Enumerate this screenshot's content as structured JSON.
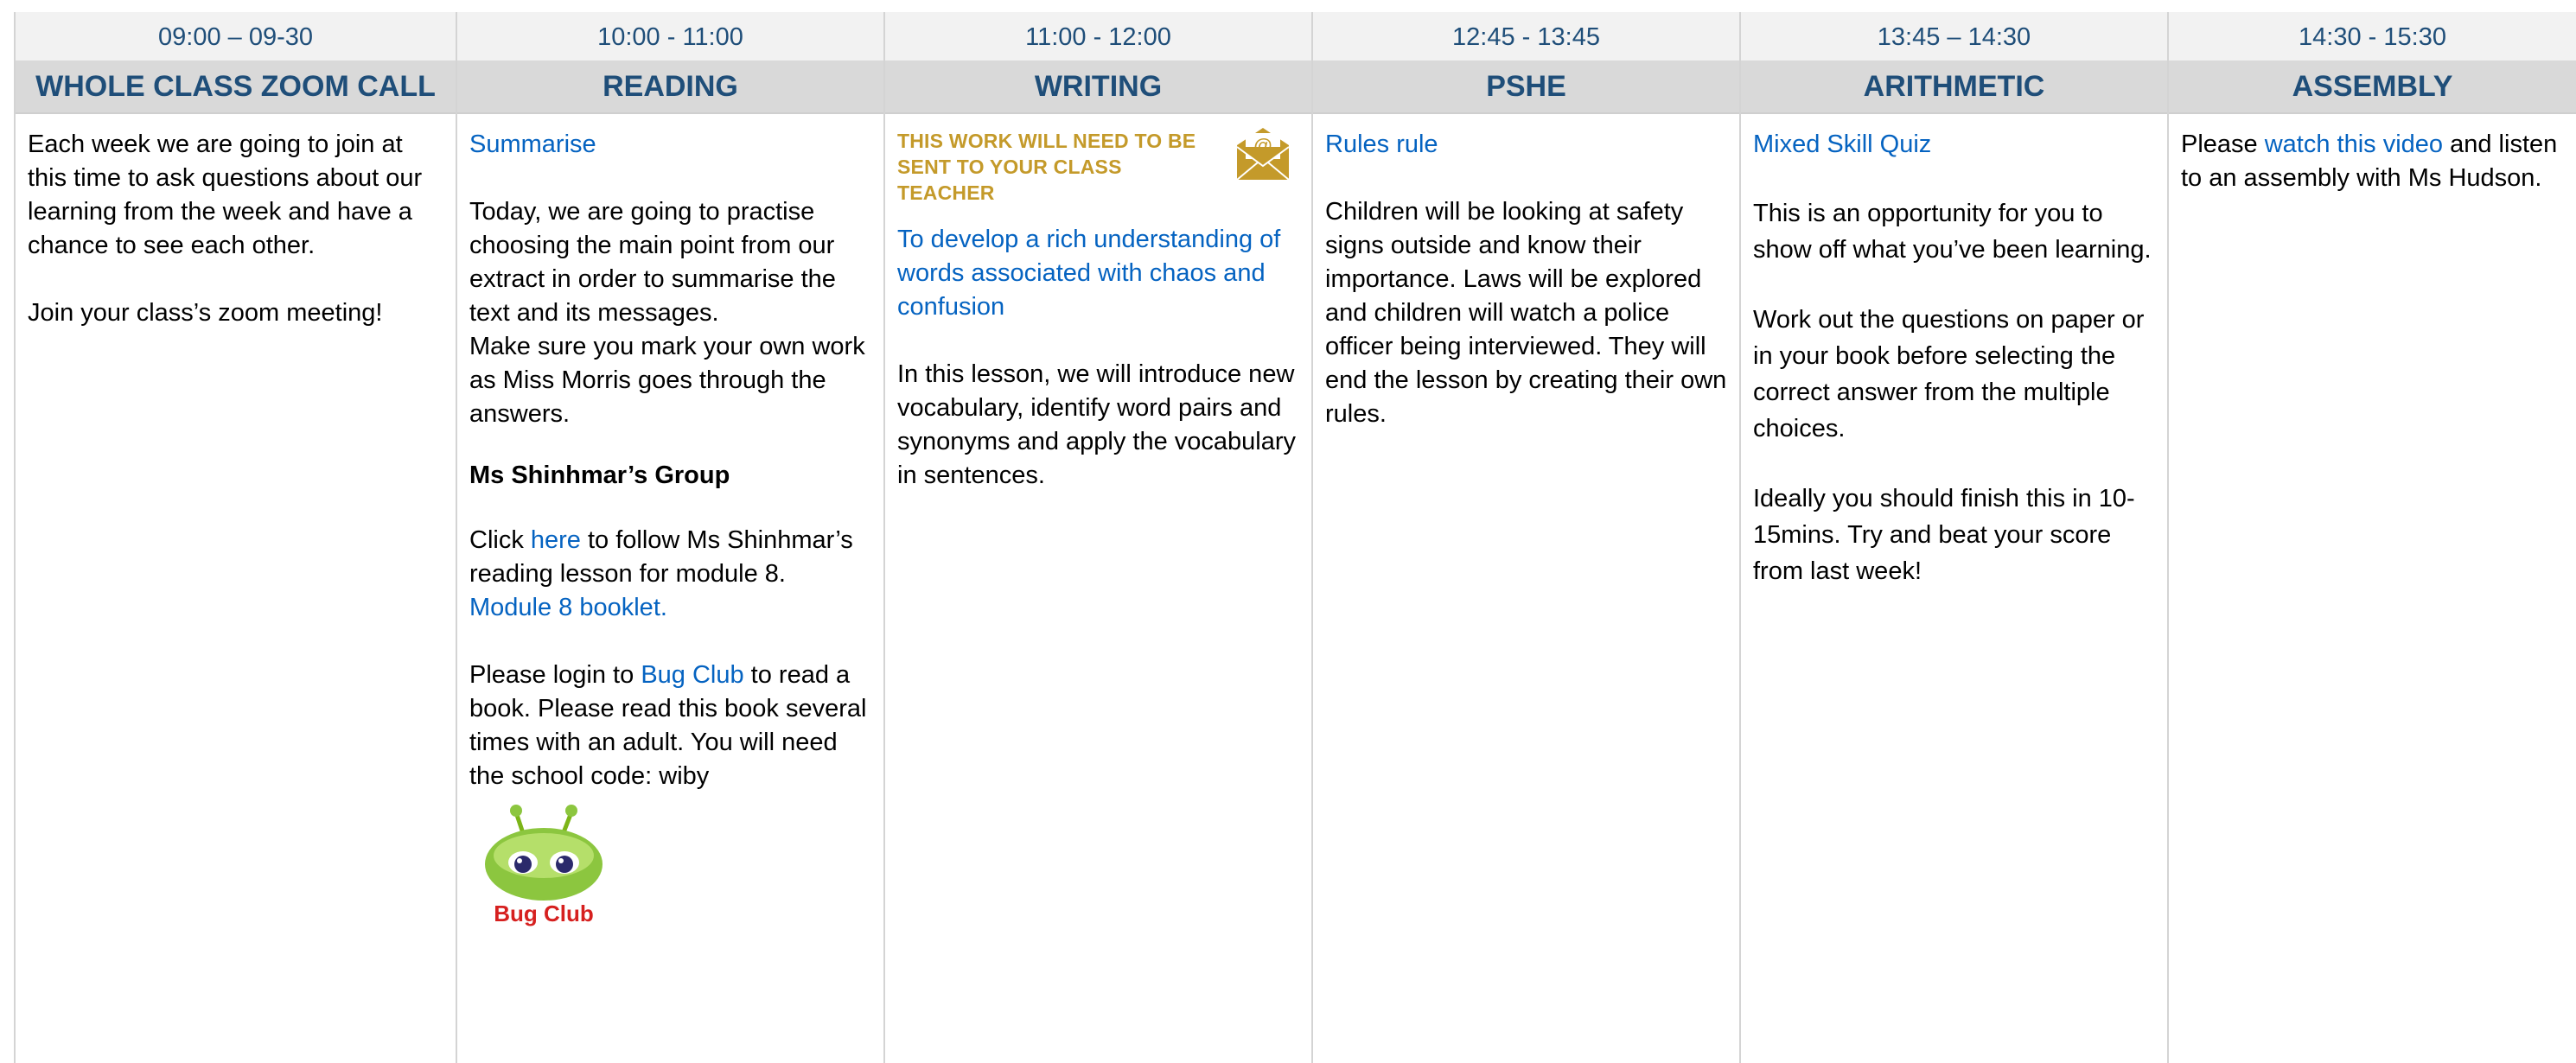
{
  "columns": [
    {
      "time": "09:00 – 09-30",
      "subject": "WHOLE CLASS ZOOM CALL",
      "p1": "Each week we are going to join at this time to ask questions about our learning from the week and have a chance to see each other.",
      "p2": "Join your class’s zoom meeting!"
    },
    {
      "time": "10:00 - 11:00",
      "subject": "READING",
      "title_link": "Summarise",
      "p1": "Today, we are going to practise choosing the main point from our extract in order to summarise the text and its messages.",
      "p2": "Make sure you mark your own work as Miss Morris goes through the answers.",
      "group_heading": "Ms Shinhmar’s Group",
      "click_pre": "Click ",
      "click_link": "here",
      "click_post": " to follow Ms Shinhmar’s reading lesson for module 8.",
      "booklet_link": "Module 8 booklet.",
      "login_pre": "Please login to ",
      "login_link": "Bug Club",
      "login_post": " to read a book.  Please read this book several times with an adult. You will need the school code: wiby",
      "logo_text": "Bug Club"
    },
    {
      "time": "11:00 - 12:00",
      "subject": "WRITING",
      "notice": "THIS WORK WILL NEED TO BE SENT TO YOUR CLASS TEACHER",
      "objective_link": "To develop a rich understanding of words associated with chaos and confusion",
      "p1": "In this lesson, we will introduce new vocabulary, identify word pairs and synonyms and apply the vocabulary in sentences."
    },
    {
      "time": "12:45 - 13:45",
      "subject": "PSHE",
      "title_link": "Rules rule",
      "p1": "Children will be looking at safety signs outside and know their importance. Laws will be explored and children will watch a police officer being interviewed. They will end the lesson by creating their own rules."
    },
    {
      "time": "13:45 – 14:30",
      "subject": "ARITHMETIC",
      "title_link": "Mixed Skill Quiz",
      "p1": "This is an opportunity for you to show off what you’ve been learning.",
      "p2": "Work out the questions on paper or in your book before selecting the correct answer from the multiple choices.",
      "p3": "Ideally you should finish this in 10-15mins.  Try and beat your score from last week!"
    },
    {
      "time": "14:30 - 15:30",
      "subject": "ASSEMBLY",
      "pre": "Please ",
      "link": "watch this video",
      "post": " and listen to an assembly with Ms Hudson."
    }
  ],
  "colors": {
    "header_text": "#1f4e79",
    "link": "#0563c1",
    "notice": "#c49a2a",
    "time_bg": "#f2f2f2",
    "subject_bg": "#d9d9d9"
  },
  "icons": [
    "email-envelope-icon",
    "bug-club-logo"
  ]
}
